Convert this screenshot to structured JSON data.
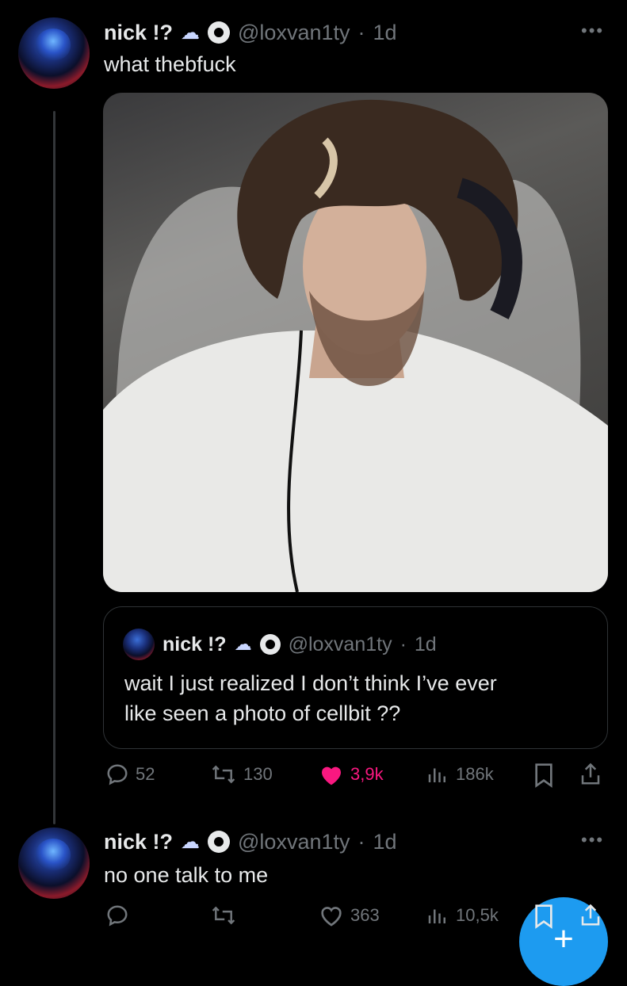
{
  "tweet1": {
    "name": "nick !?",
    "handle": "@loxvan1ty",
    "time": "1d",
    "text": "what thebfuck",
    "more": "•••",
    "quote": {
      "name": "nick !?",
      "handle": "@loxvan1ty",
      "time": "1d",
      "line1": "wait I just realized I don’t think I’ve ever",
      "line2": "like seen a photo of cellbit ??"
    },
    "actions": {
      "replies": "52",
      "reposts": "130",
      "likes": "3,9k",
      "views": "186k"
    }
  },
  "tweet2": {
    "name": "nick !?",
    "handle": "@loxvan1ty",
    "time": "1d",
    "text": "no one talk to me",
    "more": "•••",
    "actions": {
      "likes": "363",
      "views": "10,5k"
    }
  },
  "separator": "·",
  "colors": {
    "background": "#000000",
    "text": "#e7e9ea",
    "muted": "#71767b",
    "like": "#f91880",
    "accent": "#1d9bf0"
  },
  "fab": {
    "label": "+"
  }
}
